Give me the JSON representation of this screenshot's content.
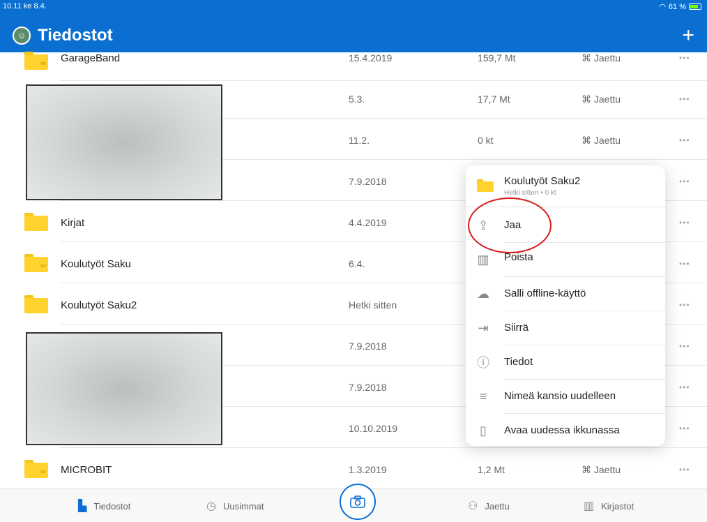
{
  "status": {
    "time": "10.11",
    "day": "ke 8.4.",
    "battery": "61 %"
  },
  "header": {
    "title": "Tiedostot",
    "add": "+"
  },
  "rows": [
    {
      "name": "GarageBand",
      "date": "15.4.2019",
      "size": "159,7 Mt",
      "share": "Jaettu",
      "more": "•••"
    },
    {
      "name": "",
      "date": "5.3.",
      "size": "17,7 Mt",
      "share": "Jaettu",
      "more": "•••"
    },
    {
      "name": "",
      "date": "11.2.",
      "size": "0 kt",
      "share": "Jaettu",
      "more": "•••"
    },
    {
      "name": "",
      "date": "7.9.2018",
      "size": "",
      "share": "",
      "more": "•••"
    },
    {
      "name": "Kirjat",
      "date": "4.4.2019",
      "size": "",
      "share": "",
      "more": "•••"
    },
    {
      "name": "Koulutyöt Saku",
      "date": "6.4.",
      "size": "",
      "share": "",
      "more": "•••"
    },
    {
      "name": "Koulutyöt Saku2",
      "date": "Hetki sitten",
      "size": "",
      "share": "",
      "more": "•••"
    },
    {
      "name": "",
      "date": "7.9.2018",
      "size": "",
      "share": "",
      "more": "•••"
    },
    {
      "name": "",
      "date": "7.9.2018",
      "size": "",
      "share": "",
      "more": "•••"
    },
    {
      "name": "",
      "date": "10.10.2019",
      "size": "",
      "share": "",
      "more": "•••"
    },
    {
      "name": "MICROBIT",
      "date": "1.3.2019",
      "size": "1,2 Mt",
      "share": "Jaettu",
      "more": "•••"
    }
  ],
  "popup": {
    "title": "Koulutyöt Saku2",
    "subtitle": "Hetki sitten • 0 kt",
    "items": [
      {
        "label": "Jaa",
        "icon": "share-icon"
      },
      {
        "label": "Poista",
        "icon": "trash-icon"
      },
      {
        "label": "Salli offline-käyttö",
        "icon": "cloud-download-icon"
      },
      {
        "label": "Siirrä",
        "icon": "move-icon"
      },
      {
        "label": "Tiedot",
        "icon": "info-icon"
      },
      {
        "label": "Nimeä kansio uudelleen",
        "icon": "rename-icon"
      },
      {
        "label": "Avaa uudessa ikkunassa",
        "icon": "new-window-icon"
      }
    ]
  },
  "tabs": [
    {
      "label": "Tiedostot",
      "icon": "file-icon",
      "active": true
    },
    {
      "label": "Uusimmat",
      "icon": "clock-icon"
    },
    {
      "label": "Jaettu",
      "icon": "people-icon"
    },
    {
      "label": "Kirjastot",
      "icon": "library-icon"
    }
  ],
  "colors": {
    "accent": "#0a6fd1",
    "folder": "#ffd22e",
    "highlight": "#d71a1a"
  }
}
